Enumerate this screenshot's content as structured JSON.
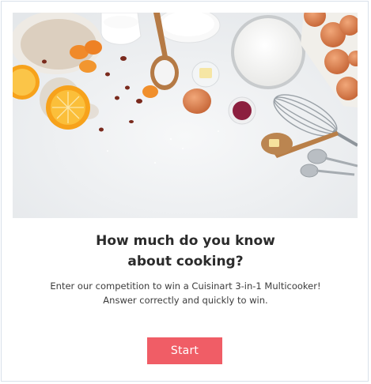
{
  "quiz": {
    "title_line1": "How much do you know",
    "title_line2": "about cooking?",
    "description_line1": "Enter our competition to win a Cuisinart 3-in-1 Multicooker!",
    "description_line2": "Answer correctly and quickly to win.",
    "start_label": "Start"
  },
  "colors": {
    "button": "#f05d66",
    "border": "#d9e1ea",
    "title_text": "#2b2b2b"
  }
}
